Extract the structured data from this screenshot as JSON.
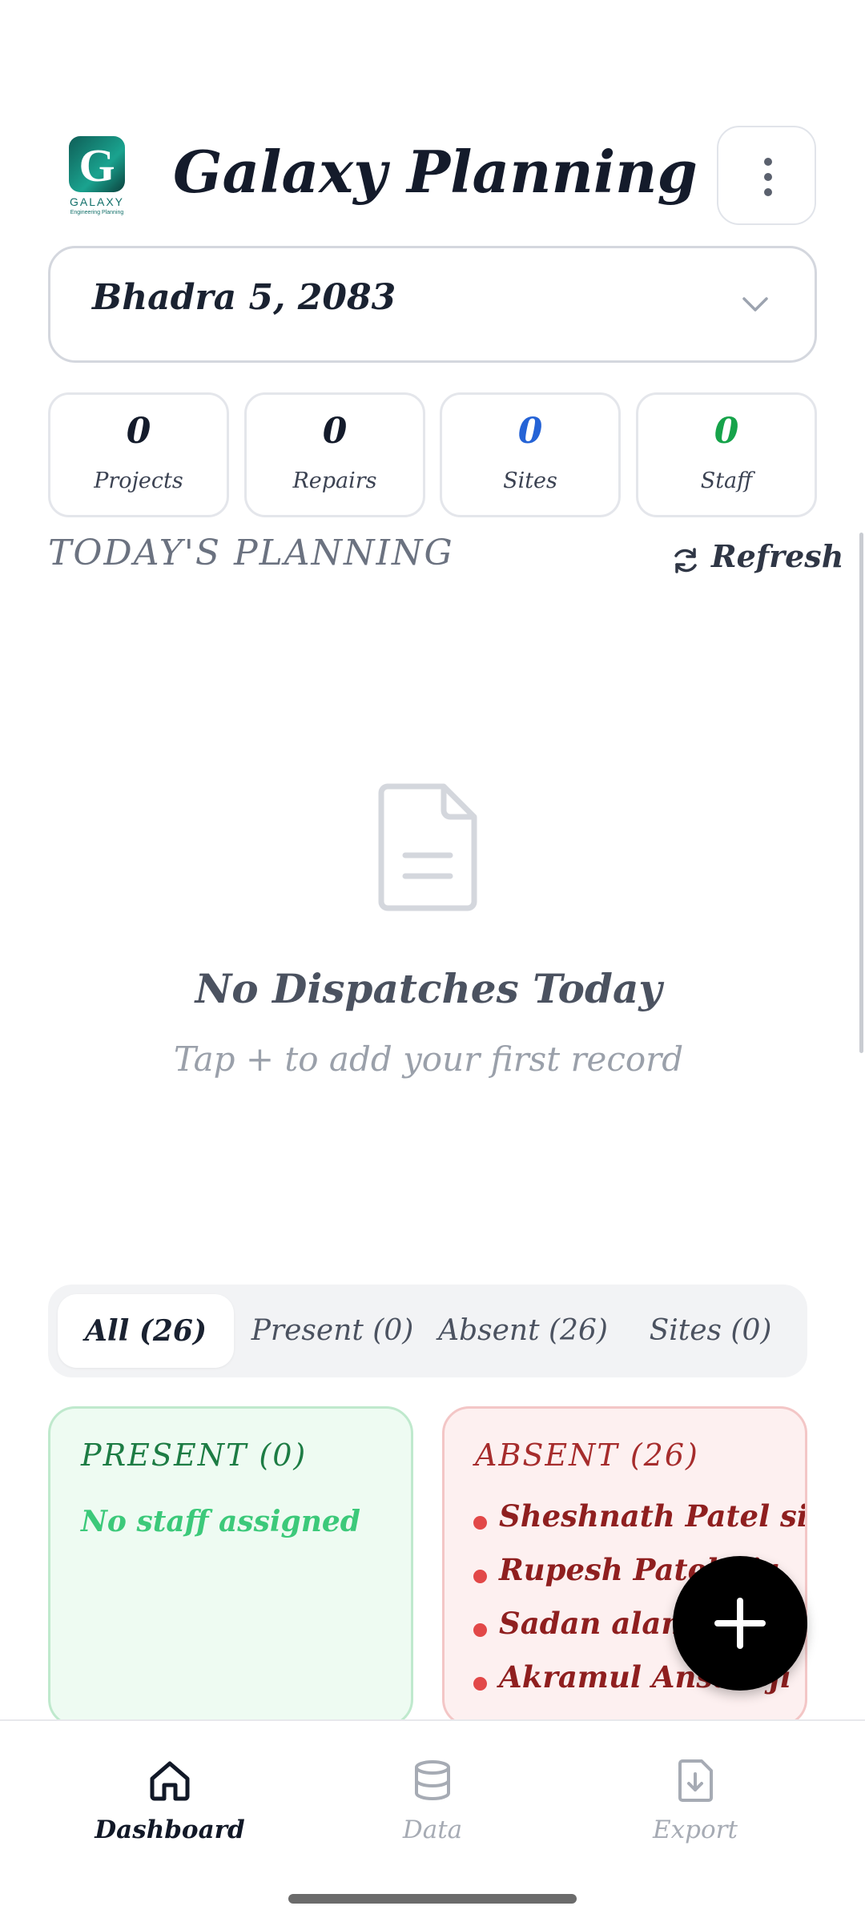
{
  "header": {
    "logo_letter": "G",
    "logo_word": "GALAXY",
    "logo_sub": "Engineering Planning",
    "title": "Galaxy Planning",
    "menu_icon": "more-vertical-icon"
  },
  "date_selector": {
    "value": "Bhadra 5, 2083",
    "icon": "chevron-down-icon"
  },
  "stats": [
    {
      "label": "Projects",
      "value": "0",
      "color": "#141b2b"
    },
    {
      "label": "Repairs",
      "value": "0",
      "color": "#141b2b"
    },
    {
      "label": "Sites",
      "value": "0",
      "color": "#2563d6"
    },
    {
      "label": "Staff",
      "value": "0",
      "color": "#16a34a"
    }
  ],
  "planning": {
    "title": "TODAY'S PLANNING",
    "refresh_label": "Refresh",
    "empty_title": "No Dispatches Today",
    "empty_subtitle": "Tap + to add your first record"
  },
  "filter_tabs": [
    {
      "label": "All (26)",
      "active": true
    },
    {
      "label": "Present (0)",
      "active": false
    },
    {
      "label": "Absent (26)",
      "active": false
    },
    {
      "label": "Sites (0)",
      "active": false
    }
  ],
  "present_card": {
    "title": "PRESENT (0)",
    "empty_text": "No staff assigned"
  },
  "absent_card": {
    "title": "ABSENT (26)",
    "names": [
      "Sheshnath Patel sir",
      "Rupesh Patel Sir",
      "Sadan alam sir",
      "Akramul Ansari ji"
    ]
  },
  "bottom_nav": [
    {
      "label": "Dashboard",
      "icon": "home-icon",
      "active": true
    },
    {
      "label": "Data",
      "icon": "database-icon",
      "active": false
    },
    {
      "label": "Export",
      "icon": "file-download-icon",
      "active": false
    }
  ],
  "colors": {
    "accent": "#000000",
    "present_green": "#1d7c44",
    "absent_red": "#a62c2c"
  }
}
